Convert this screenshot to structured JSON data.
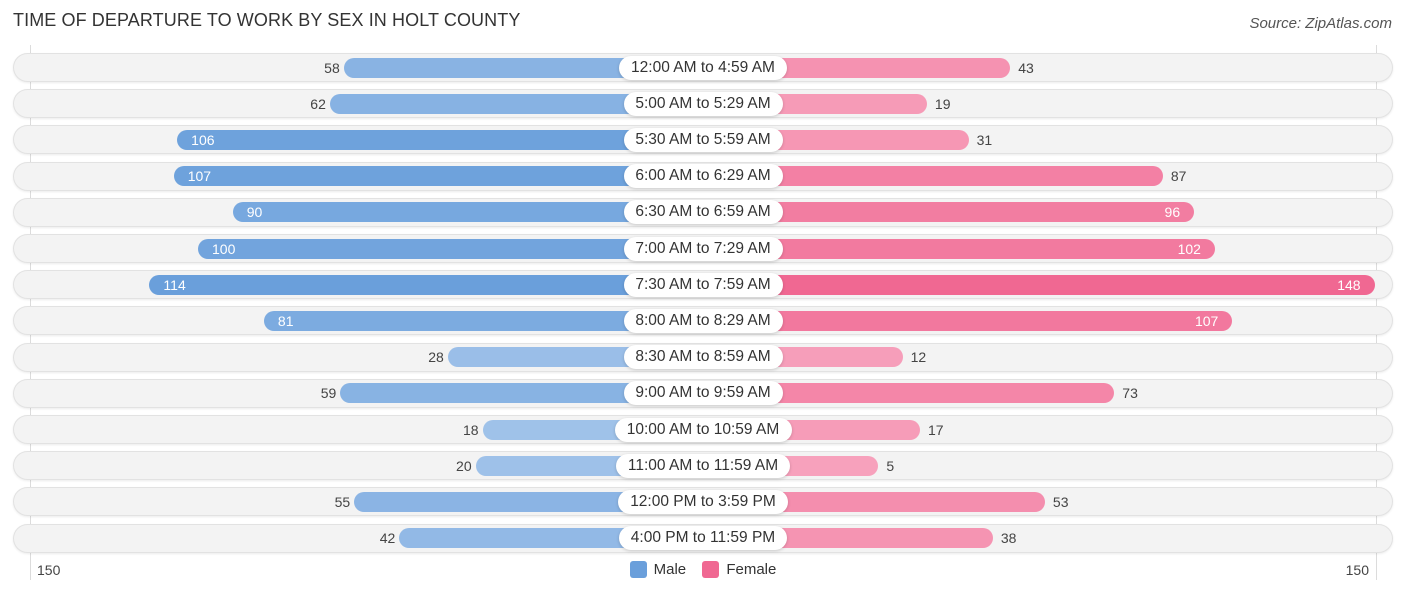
{
  "title": "TIME OF DEPARTURE TO WORK BY SEX IN HOLT COUNTY",
  "source": "Source: ZipAtlas.com",
  "colors": {
    "male": "#6a9fdb",
    "female": "#f06892",
    "male_light": "#a9c8ec",
    "female_light": "#f7a3bd"
  },
  "chart_data": {
    "type": "bar",
    "orientation": "horizontal-diverging",
    "title": "TIME OF DEPARTURE TO WORK BY SEX IN HOLT COUNTY",
    "categories": [
      "12:00 AM to 4:59 AM",
      "5:00 AM to 5:29 AM",
      "5:30 AM to 5:59 AM",
      "6:00 AM to 6:29 AM",
      "6:30 AM to 6:59 AM",
      "7:00 AM to 7:29 AM",
      "7:30 AM to 7:59 AM",
      "8:00 AM to 8:29 AM",
      "8:30 AM to 8:59 AM",
      "9:00 AM to 9:59 AM",
      "10:00 AM to 10:59 AM",
      "11:00 AM to 11:59 AM",
      "12:00 PM to 3:59 PM",
      "4:00 PM to 11:59 PM"
    ],
    "series": [
      {
        "name": "Male",
        "values": [
          58,
          62,
          106,
          107,
          90,
          100,
          114,
          81,
          28,
          59,
          18,
          20,
          55,
          42
        ]
      },
      {
        "name": "Female",
        "values": [
          43,
          19,
          31,
          87,
          96,
          102,
          148,
          107,
          12,
          73,
          17,
          5,
          53,
          38
        ]
      }
    ],
    "axis": {
      "left_tick": "150",
      "right_tick": "150",
      "max": 150
    },
    "legend": {
      "position": "bottom-center",
      "entries": [
        "Male",
        "Female"
      ]
    }
  }
}
